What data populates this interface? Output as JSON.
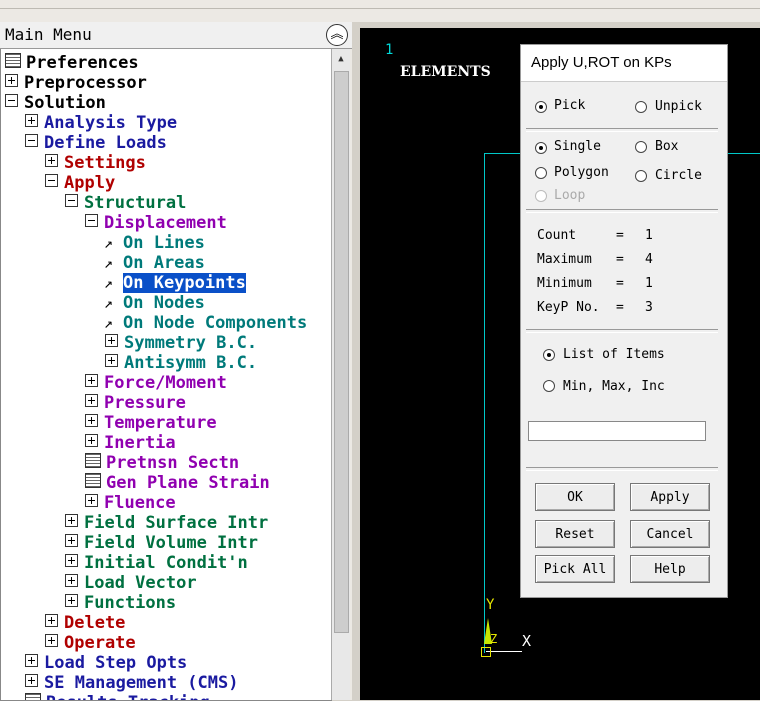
{
  "main_menu": {
    "title": "Main Menu",
    "items": [
      {
        "label": "Preferences",
        "icon": "grid-icon"
      },
      {
        "label": "Preprocessor",
        "icon": "expand-plus-icon"
      },
      {
        "label": "Solution",
        "icon": "collapse-minus-icon"
      },
      {
        "label": "Analysis Type",
        "icon": "expand-plus-icon"
      },
      {
        "label": "Define Loads",
        "icon": "collapse-minus-icon"
      },
      {
        "label": "Settings",
        "icon": "expand-plus-icon"
      },
      {
        "label": "Apply",
        "icon": "collapse-minus-icon"
      },
      {
        "label": "Structural",
        "icon": "collapse-minus-icon"
      },
      {
        "label": "Displacement",
        "icon": "collapse-minus-icon"
      },
      {
        "label": "On Lines",
        "icon": "pick-arrow-icon"
      },
      {
        "label": "On Areas",
        "icon": "pick-arrow-icon"
      },
      {
        "label": "On Keypoints",
        "icon": "pick-arrow-icon",
        "selected": true
      },
      {
        "label": "On Nodes",
        "icon": "pick-arrow-icon"
      },
      {
        "label": "On Node Components",
        "icon": "pick-arrow-icon"
      },
      {
        "label": "Symmetry B.C.",
        "icon": "expand-plus-icon"
      },
      {
        "label": "Antisymm B.C.",
        "icon": "expand-plus-icon"
      },
      {
        "label": "Force/Moment",
        "icon": "expand-plus-icon"
      },
      {
        "label": "Pressure",
        "icon": "expand-plus-icon"
      },
      {
        "label": "Temperature",
        "icon": "expand-plus-icon"
      },
      {
        "label": "Inertia",
        "icon": "expand-plus-icon"
      },
      {
        "label": "Pretnsn Sectn",
        "icon": "grid-icon"
      },
      {
        "label": "Gen Plane Strain",
        "icon": "grid-icon"
      },
      {
        "label": "Fluence",
        "icon": "expand-plus-icon"
      },
      {
        "label": "Field Surface Intr",
        "icon": "expand-plus-icon"
      },
      {
        "label": "Field Volume Intr",
        "icon": "expand-plus-icon"
      },
      {
        "label": "Initial Condit'n",
        "icon": "expand-plus-icon"
      },
      {
        "label": "Load Vector",
        "icon": "expand-plus-icon"
      },
      {
        "label": "Functions",
        "icon": "expand-plus-icon"
      },
      {
        "label": "Delete",
        "icon": "expand-plus-icon"
      },
      {
        "label": "Operate",
        "icon": "expand-plus-icon"
      },
      {
        "label": "Load Step Opts",
        "icon": "expand-plus-icon"
      },
      {
        "label": "SE Management (CMS)",
        "icon": "expand-plus-icon"
      },
      {
        "label": "Results Tracking",
        "icon": "grid-icon"
      }
    ]
  },
  "graphics": {
    "window_number": "1",
    "label": "ELEMENTS",
    "axis_y": "Y",
    "axis_z": "Z",
    "axis_x": "X"
  },
  "dialog": {
    "title": "Apply U,ROT on KPs",
    "pick": "Pick",
    "unpick": "Unpick",
    "single": "Single",
    "box": "Box",
    "polygon": "Polygon",
    "circle": "Circle",
    "loop": "Loop",
    "count_label": "Count",
    "count_value": "1",
    "maximum_label": "Maximum",
    "maximum_value": "4",
    "minimum_label": "Minimum",
    "minimum_value": "1",
    "keyp_label": "KeyP No.",
    "keyp_value": "3",
    "eq": "=",
    "list_of_items": "List of Items",
    "min_max_inc": "Min, Max, Inc",
    "filter_value": "",
    "buttons": {
      "ok": "OK",
      "apply": "Apply",
      "reset": "Reset",
      "cancel": "Cancel",
      "pick_all": "Pick All",
      "help": "Help"
    }
  }
}
